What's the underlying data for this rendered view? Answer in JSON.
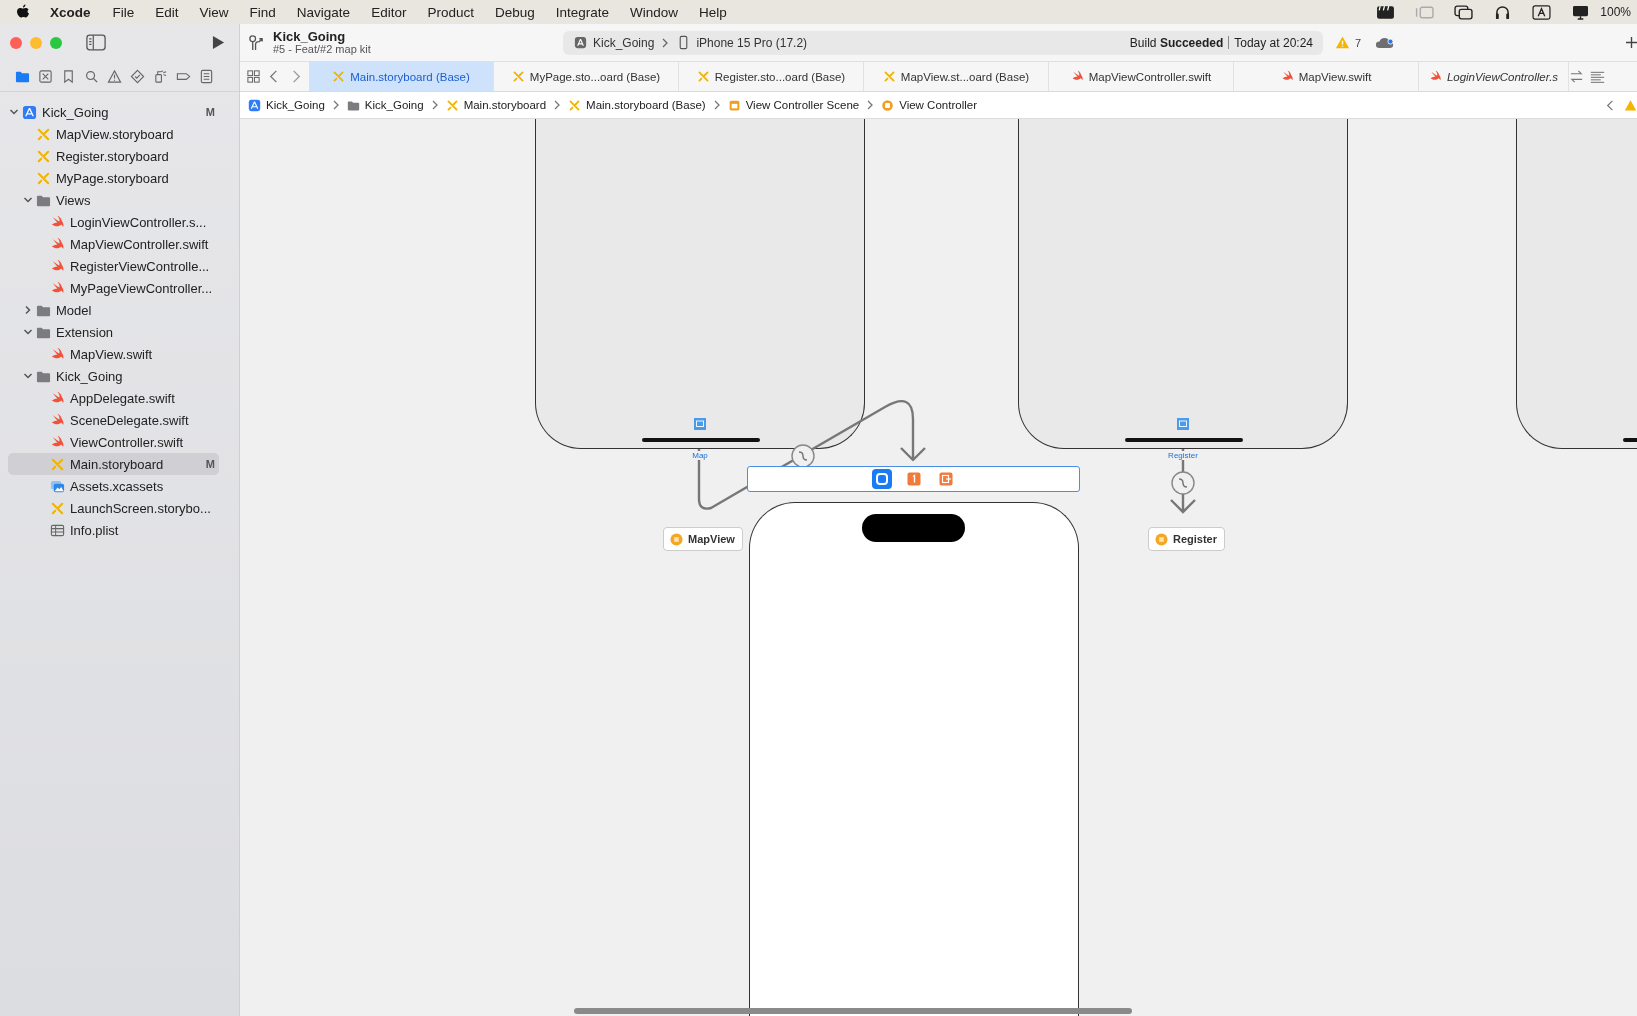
{
  "menu_bar": {
    "app": "Xcode",
    "items": [
      "File",
      "Edit",
      "View",
      "Find",
      "Navigate",
      "Editor",
      "Product",
      "Debug",
      "Integrate",
      "Window",
      "Help"
    ],
    "battery": "100%"
  },
  "toolbar": {
    "project": "Kick_Going",
    "branch": "#5 - Feat/#2 map kit",
    "scheme": "Kick_Going",
    "device": "iPhone 15 Pro (17.2)",
    "status": "Build **Succeeded**",
    "time": "Today at 20:24",
    "warnings": "7"
  },
  "navigator_tabs": [
    {
      "kind": "folder",
      "selected": true
    },
    {
      "kind": "source",
      "selected": false
    },
    {
      "kind": "bookmark",
      "selected": false
    },
    {
      "kind": "search",
      "selected": false
    },
    {
      "kind": "issue",
      "selected": false
    },
    {
      "kind": "test",
      "selected": false
    },
    {
      "kind": "debug",
      "selected": false
    },
    {
      "kind": "breakpoint",
      "selected": false
    },
    {
      "kind": "report",
      "selected": false
    }
  ],
  "navigator": {
    "items": [
      {
        "label": "Kick_Going",
        "kind": "project",
        "badge": "M",
        "expanded": true,
        "selected": false,
        "children": [
          {
            "label": "MapView.storyboard",
            "kind": "storyboard",
            "selected": false
          },
          {
            "label": "Register.storyboard",
            "kind": "storyboard",
            "selected": false
          },
          {
            "label": "MyPage.storyboard",
            "kind": "storyboard",
            "selected": false
          },
          {
            "label": "Views",
            "kind": "folder",
            "expanded": true,
            "selected": false,
            "children": [
              {
                "label": "LoginViewController.s...",
                "kind": "swift",
                "selected": false
              },
              {
                "label": "MapViewController.swift",
                "kind": "swift",
                "selected": false
              },
              {
                "label": "RegisterViewControlle...",
                "kind": "swift",
                "selected": false
              },
              {
                "label": "MyPageViewController...",
                "kind": "swift",
                "selected": false
              }
            ]
          },
          {
            "label": "Model",
            "kind": "folder",
            "expanded": false,
            "selected": false
          },
          {
            "label": "Extension",
            "kind": "folder",
            "expanded": true,
            "selected": false,
            "children": [
              {
                "label": "MapView.swift",
                "kind": "swift",
                "selected": false
              }
            ]
          },
          {
            "label": "Kick_Going",
            "kind": "folder",
            "expanded": true,
            "selected": false,
            "children": [
              {
                "label": "AppDelegate.swift",
                "kind": "swift",
                "selected": false
              },
              {
                "label": "SceneDelegate.swift",
                "kind": "swift",
                "selected": false
              },
              {
                "label": "ViewController.swift",
                "kind": "swift",
                "selected": false
              },
              {
                "label": "Main.storyboard",
                "kind": "storyboard",
                "badge": "M",
                "selected": true
              },
              {
                "label": "Assets.xcassets",
                "kind": "assets",
                "selected": false
              },
              {
                "label": "LaunchScreen.storybo...",
                "kind": "storyboard",
                "selected": false
              },
              {
                "label": "Info.plist",
                "kind": "plist",
                "selected": false
              }
            ]
          }
        ]
      }
    ]
  },
  "tabs": [
    {
      "label": "Main.storyboard (Base)",
      "kind": "storyboard",
      "selected": true,
      "preview": false
    },
    {
      "label": "MyPage.sto...oard (Base)",
      "kind": "storyboard",
      "selected": false,
      "preview": false
    },
    {
      "label": "Register.sto...oard (Base)",
      "kind": "storyboard",
      "selected": false,
      "preview": false
    },
    {
      "label": "MapView.st...oard (Base)",
      "kind": "storyboard",
      "selected": false,
      "preview": false
    },
    {
      "label": "MapViewController.swift",
      "kind": "swift",
      "selected": false,
      "preview": false
    },
    {
      "label": "MapView.swift",
      "kind": "swift",
      "selected": false,
      "preview": false
    },
    {
      "label": "LoginViewController.s",
      "kind": "swift",
      "selected": false,
      "preview": true
    }
  ],
  "breadcrumb": [
    {
      "label": "Kick_Going",
      "kind": "project"
    },
    {
      "label": "Kick_Going",
      "kind": "folder"
    },
    {
      "label": "Main.storyboard",
      "kind": "storyboard"
    },
    {
      "label": "Main.storyboard (Base)",
      "kind": "storyboard"
    },
    {
      "label": "View Controller Scene",
      "kind": "scene"
    },
    {
      "label": "View Controller",
      "kind": "controller"
    }
  ],
  "canvas": {
    "scene_labels": [
      "Map",
      "Register"
    ],
    "scene_dock": [
      {
        "kind": "view_controller",
        "selected": true
      },
      {
        "kind": "first_responder",
        "selected": false
      },
      {
        "kind": "exit",
        "selected": false
      }
    ],
    "references": [
      {
        "label": "MapView"
      },
      {
        "label": "Register"
      }
    ]
  }
}
